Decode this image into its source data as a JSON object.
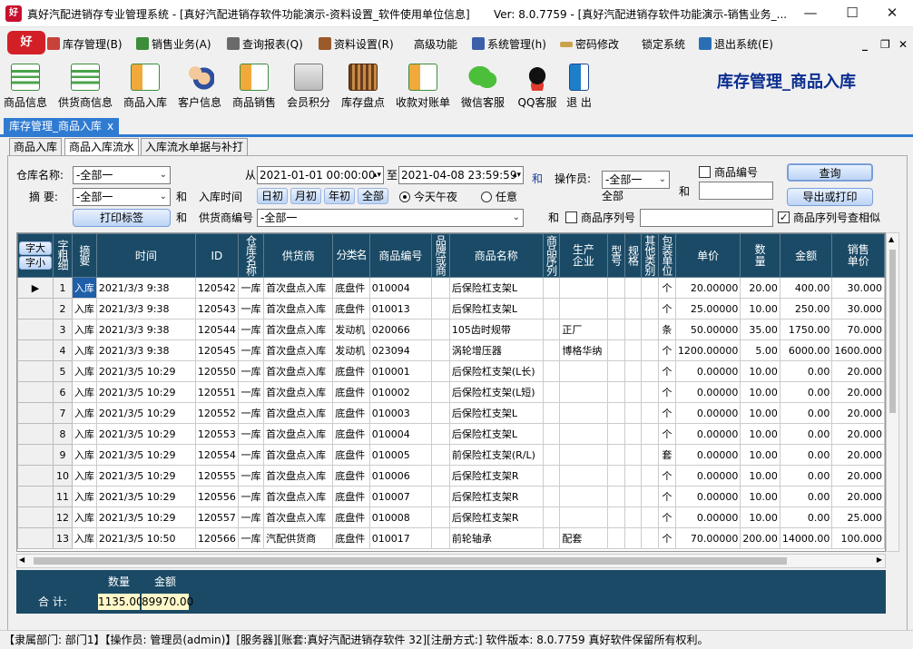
{
  "window": {
    "app_badge": "好",
    "title": "真好汽配进销存专业管理系统 - [真好汽配进销存软件功能演示-资料设置_软件使用单位信息]",
    "version": "Ver: 8.0.7759 - [真好汽配进销存软件功能演示-销售业务_...",
    "minimize": "—",
    "maximize": "☐",
    "close": "✕"
  },
  "menu": {
    "items": [
      "库存管理(B)",
      "销售业务(A)",
      "查询报表(Q)",
      "资料设置(R)",
      "高级功能",
      "系统管理(h)",
      "密码修改",
      "锁定系统",
      "退出系统(E)"
    ],
    "mdi_min": "_",
    "mdi_restore": "❐",
    "mdi_close": "✕"
  },
  "toolbar": {
    "items": [
      "商品信息",
      "供货商信息",
      "商品入库",
      "客户信息",
      "商品销售",
      "会员积分",
      "库存盘点",
      "收款对账单",
      "微信客服",
      "QQ客服",
      "退 出"
    ]
  },
  "page_title": "库存管理_商品入库",
  "doc_tab": {
    "label": "库存管理_商品入库",
    "close": "x"
  },
  "sub_tabs": [
    "商品入库",
    "商品入库流水",
    "入库流水单据与补打"
  ],
  "filters": {
    "warehouse_label": "仓库名称:",
    "warehouse_value": "-全部一",
    "summary_label": "摘  要:",
    "summary_value": "-全部一",
    "and1": "和",
    "in_time_label": "入库时间",
    "from_label": "从",
    "from_value": "2021-01-01 00:00:00",
    "to_label": "至",
    "to_value": "2021-04-08 23:59:59",
    "and_blue": "和",
    "operator_label": "操作员:",
    "operator_value": "-全部一",
    "operator_sub": "全部",
    "goods_code_label": "商品编号",
    "goods_code_value": "",
    "and2": "和",
    "quick": [
      "日初",
      "月初",
      "年初",
      "全部"
    ],
    "today_label": "今天午夜",
    "any_label": "任意",
    "print_label_btn": "打印标签",
    "and3": "和",
    "supplier_label": "供货商编号",
    "supplier_value": "-全部一",
    "and4": "和",
    "serial_label": "商品序列号",
    "serial_value": "",
    "fuzzy_label": "商品序列号查相似",
    "query_btn": "查询",
    "export_btn": "导出或打印"
  },
  "grid": {
    "corner_big": "字大",
    "corner_small": "字小",
    "corner_label": "字粗细",
    "columns": [
      "摘要",
      "时间",
      "ID",
      "仓库名称",
      "供货商",
      "分类名",
      "商品编号",
      "品牌或商",
      "商品名称",
      "商品序列",
      "生产企业",
      "型号",
      "规格",
      "其他类别",
      "包装单位",
      "单价",
      "数量",
      "金额",
      "销售单价"
    ],
    "row_marker": "▶",
    "rows": [
      [
        "1",
        "入库",
        "2021/3/3 9:38",
        "120542",
        "一库",
        "首次盘点入库",
        "底盘件",
        "010004",
        "",
        "后保险杠支架L",
        "",
        "",
        "",
        "",
        "",
        "个",
        "20.00000",
        "20.00",
        "400.00",
        "30.000"
      ],
      [
        "2",
        "入库",
        "2021/3/3 9:38",
        "120543",
        "一库",
        "首次盘点入库",
        "底盘件",
        "010013",
        "",
        "后保险杠支架L",
        "",
        "",
        "",
        "",
        "",
        "个",
        "25.00000",
        "10.00",
        "250.00",
        "30.000"
      ],
      [
        "3",
        "入库",
        "2021/3/3 9:38",
        "120544",
        "一库",
        "首次盘点入库",
        "发动机",
        "020066",
        "",
        "105齿时规带",
        "",
        "正厂",
        "",
        "",
        "",
        "条",
        "50.00000",
        "35.00",
        "1750.00",
        "70.000"
      ],
      [
        "4",
        "入库",
        "2021/3/3 9:38",
        "120545",
        "一库",
        "首次盘点入库",
        "发动机",
        "023094",
        "",
        "涡轮增压器",
        "",
        "博格华纳",
        "",
        "",
        "",
        "个",
        "1200.00000",
        "5.00",
        "6000.00",
        "1600.000"
      ],
      [
        "5",
        "入库",
        "2021/3/5 10:29",
        "120550",
        "一库",
        "首次盘点入库",
        "底盘件",
        "010001",
        "",
        "后保险杠支架(L长)",
        "",
        "",
        "",
        "",
        "",
        "个",
        "0.00000",
        "10.00",
        "0.00",
        "20.000"
      ],
      [
        "6",
        "入库",
        "2021/3/5 10:29",
        "120551",
        "一库",
        "首次盘点入库",
        "底盘件",
        "010002",
        "",
        "后保险杠支架(L短)",
        "",
        "",
        "",
        "",
        "",
        "个",
        "0.00000",
        "10.00",
        "0.00",
        "20.000"
      ],
      [
        "7",
        "入库",
        "2021/3/5 10:29",
        "120552",
        "一库",
        "首次盘点入库",
        "底盘件",
        "010003",
        "",
        "后保险杠支架L",
        "",
        "",
        "",
        "",
        "",
        "个",
        "0.00000",
        "10.00",
        "0.00",
        "20.000"
      ],
      [
        "8",
        "入库",
        "2021/3/5 10:29",
        "120553",
        "一库",
        "首次盘点入库",
        "底盘件",
        "010004",
        "",
        "后保险杠支架L",
        "",
        "",
        "",
        "",
        "",
        "个",
        "0.00000",
        "10.00",
        "0.00",
        "20.000"
      ],
      [
        "9",
        "入库",
        "2021/3/5 10:29",
        "120554",
        "一库",
        "首次盘点入库",
        "底盘件",
        "010005",
        "",
        "前保险杠支架(R/L)",
        "",
        "",
        "",
        "",
        "",
        "套",
        "0.00000",
        "10.00",
        "0.00",
        "20.000"
      ],
      [
        "10",
        "入库",
        "2021/3/5 10:29",
        "120555",
        "一库",
        "首次盘点入库",
        "底盘件",
        "010006",
        "",
        "后保险杠支架R",
        "",
        "",
        "",
        "",
        "",
        "个",
        "0.00000",
        "10.00",
        "0.00",
        "20.000"
      ],
      [
        "11",
        "入库",
        "2021/3/5 10:29",
        "120556",
        "一库",
        "首次盘点入库",
        "底盘件",
        "010007",
        "",
        "后保险杠支架R",
        "",
        "",
        "",
        "",
        "",
        "个",
        "0.00000",
        "10.00",
        "0.00",
        "20.000"
      ],
      [
        "12",
        "入库",
        "2021/3/5 10:29",
        "120557",
        "一库",
        "首次盘点入库",
        "底盘件",
        "010008",
        "",
        "后保险杠支架R",
        "",
        "",
        "",
        "",
        "",
        "个",
        "0.00000",
        "10.00",
        "0.00",
        "25.000"
      ],
      [
        "13",
        "入库",
        "2021/3/5 10:50",
        "120566",
        "一库",
        "汽配供货商",
        "底盘件",
        "010017",
        "",
        "前轮轴承",
        "",
        "配套",
        "",
        "",
        "",
        "个",
        "70.00000",
        "200.00",
        "14000.00",
        "100.000"
      ]
    ]
  },
  "footer": {
    "qty_label": "数量",
    "amount_label": "金额",
    "total_label": "合  计:",
    "qty_value": "1135.00",
    "amount_value": "89970.00"
  },
  "status": "【隶属部门: 部门1】【操作员: 管理员(admin)】[服务器][账套:真好汽配进销存软件 32][注册方式:] 软件版本: 8.0.7759 真好软件保留所有权利。"
}
